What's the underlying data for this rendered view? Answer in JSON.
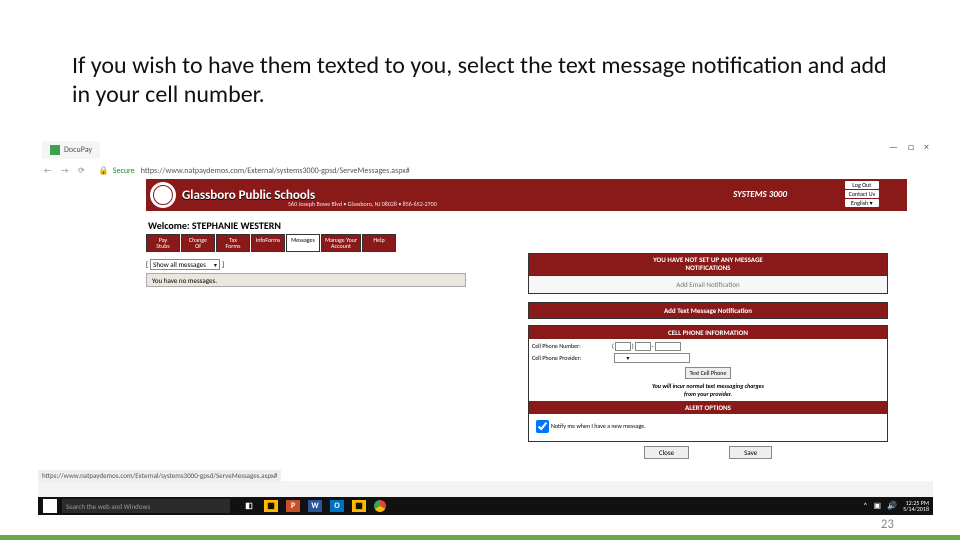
{
  "instruction": "If you wish to have them texted to you, select the text message notification and add in your cell number.",
  "browser": {
    "tab_title": "DocuPay",
    "secure_label": "Secure",
    "url": "https://www.natpaydemos.com/External/systems3000-gpsd/ServeMessages.aspx#",
    "window_min": "—",
    "window_max": "□",
    "window_close": "×"
  },
  "header": {
    "district": "Glassboro Public Schools",
    "address": "560 Joseph Bowe Blvd • Glassboro, NJ 08028 • 856-652-2700",
    "system": "SYSTEMS 3000",
    "logout": "Log Out",
    "contact": "Contact Us",
    "lang": "English ▾"
  },
  "welcome_label": "Welcome:",
  "welcome_name": "STEPHANIE WESTERN",
  "tabs": [
    {
      "l1": "Pay",
      "l2": "Stubs"
    },
    {
      "l1": "Change",
      "l2": "Of"
    },
    {
      "l1": "Tax",
      "l2": "Forms"
    },
    {
      "l1": "InfoForms",
      "l2": ""
    },
    {
      "l1": "Messages",
      "l2": ""
    },
    {
      "l1": "Manage Your",
      "l2": "Account"
    },
    {
      "l1": "Help",
      "l2": ""
    }
  ],
  "filter": {
    "bracket_l": "[",
    "label": "Show all messages",
    "bracket_r": "]"
  },
  "no_messages": "You have no messages.",
  "right": {
    "warning_l1": "YOU HAVE NOT SET UP ANY MESSAGE",
    "warning_l2": "NOTIFICATIONS",
    "add_email": "Add Email Notification",
    "add_text": "Add Text Message Notification",
    "cellinfo_hdr": "CELL PHONE INFORMATION",
    "cell_num_label": "Cell Phone Number:",
    "paren_l": "(",
    "paren_r": ")",
    "dash": "-",
    "provider_label": "Cell Phone Provider:",
    "test_btn": "Test Cell Phone",
    "charge_l1": "You will incur normal text messaging charges",
    "charge_l2": "from your provider.",
    "alert_hdr": "ALERT OPTIONS",
    "notify_label": "Notify me when I have a new message.",
    "close": "Close",
    "save": "Save"
  },
  "status_url": "https://www.natpaydemos.com/External/systems3000-gpsd/ServeMessages.aspx#",
  "taskbar": {
    "search_placeholder": "Search the web and Windows",
    "time": "12:25 PM",
    "date": "5/14/2018"
  },
  "pagenum": "23"
}
